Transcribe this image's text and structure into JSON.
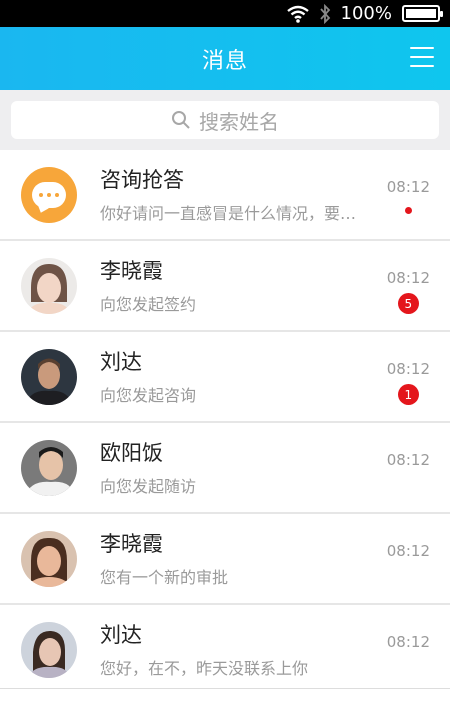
{
  "status": {
    "battery": "100%",
    "battery_level": 1.0
  },
  "header": {
    "title": "消息"
  },
  "search": {
    "placeholder": "搜索姓名"
  },
  "messages": [
    {
      "name": "咨询抢答",
      "preview": "你好请问一直感冒是什么情况，要…",
      "time": "08:12",
      "indicator": "dot"
    },
    {
      "name": "李晓霞",
      "preview": "向您发起签约",
      "time": "08:12",
      "badge": "5"
    },
    {
      "name": "刘达",
      "preview": "向您发起咨询",
      "time": "08:12",
      "badge": "1"
    },
    {
      "name": "欧阳饭",
      "preview": "向您发起随访",
      "time": "08:12"
    },
    {
      "name": "李晓霞",
      "preview": "您有一个新的审批",
      "time": "08:12"
    },
    {
      "name": "刘达",
      "preview": "您好，在不，昨天没联系上你",
      "time": "08:12"
    }
  ],
  "colors": {
    "header": "#1ab7f0",
    "badge": "#e4161c",
    "consult_avatar": "#f7a63a"
  }
}
